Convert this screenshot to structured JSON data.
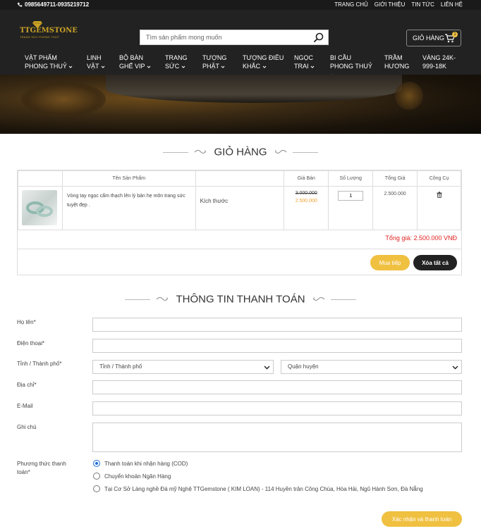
{
  "topbar": {
    "phone": "0985649711-0935219712",
    "nav": [
      "TRANG CHỦ",
      "GIỚI THIỆU",
      "TIN TỨC",
      "LIÊN HỆ"
    ]
  },
  "header": {
    "logo_brand": "TTGEMSTONE",
    "logo_tagline": "TRANG SỨC PHONG THUỶ",
    "search_placeholder": "Tìm sản phẩm mong muốn",
    "cart_label": "GIỎ HÀNG",
    "cart_count": "1"
  },
  "menu": [
    {
      "l1": "VẬT PHẨM",
      "l2": "PHONG THUỶ"
    },
    {
      "l1": "LINH",
      "l2": "VẬT"
    },
    {
      "l1": "BỘ BÀN",
      "l2": "GHẾ VIP"
    },
    {
      "l1": "TRANG",
      "l2": "SỨC"
    },
    {
      "l1": "TƯỢNG",
      "l2": "PHẬT"
    },
    {
      "l1": "TƯỢNG ĐIÊU",
      "l2": "KHẮC"
    },
    {
      "l1": "NGỌC",
      "l2": "TRAI"
    },
    {
      "l1": "BI CẦU",
      "l2": "PHONG THUỶ"
    },
    {
      "l1": "TRẦM",
      "l2": "HƯƠNG"
    },
    {
      "l1": "VÀNG 24K-",
      "l2": "999-18K"
    }
  ],
  "cart": {
    "title": "GIỎ HÀNG",
    "columns": {
      "name": "Tên Sản Phẩm",
      "price": "Giá Bán",
      "qty": "Số Lượng",
      "total": "Tổng Giá",
      "tools": "Công Cụ"
    },
    "item": {
      "name": "Vòng tay ngọc cẩm thạch lên lý bản hẹ môn trang sức tuyệt đẹp .",
      "size": "Kích thước",
      "price_old": "3.000.000",
      "price_new": "2.500.000",
      "qty": "1",
      "total": "2.500.000"
    },
    "grand_total": "Tổng giá: 2.500.000 VNĐ",
    "continue_label": "Mua tiếp",
    "clear_label": "Xóa tất cả"
  },
  "checkout": {
    "title": "THÔNG TIN THANH TOÁN",
    "labels": {
      "name": "Họ tên*",
      "phone": "Điện thoại*",
      "city": "Tỉnh / Thành phố*",
      "address": "Địa chỉ*",
      "email": "E-Mail",
      "note": "Ghi chú",
      "payment_l1": "Phương thức thanh",
      "payment_l2": "toán*"
    },
    "city_select": "Tỉnh / Thành phố",
    "district_select": "Quận huyện",
    "payment_options": [
      "Thanh toán khi nhận hàng (COD)",
      "Chuyển khoản Ngân Hàng",
      "Tại Cơ Sở Làng nghề Đá mỹ Nghệ TTGemstone ( KIM LOAN) - 114 Huyền trân Công Chúa, Hòa Hải, Ngũ Hành Sơn, Đà Nẵng"
    ],
    "submit_label": "Xác nhận và thanh toán"
  }
}
